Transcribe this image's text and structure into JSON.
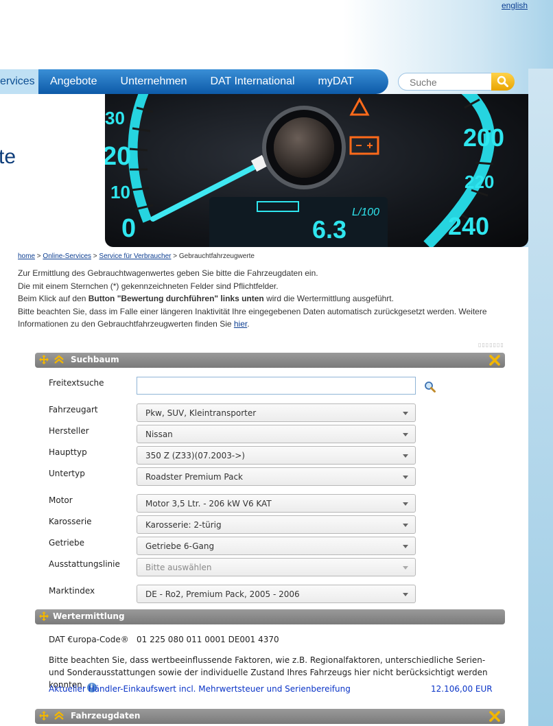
{
  "header": {
    "language_link": "english"
  },
  "nav": {
    "items": [
      {
        "label": "ervices",
        "active": true
      },
      {
        "label": "Angebote"
      },
      {
        "label": "Unternehmen"
      },
      {
        "label": "DAT International"
      },
      {
        "label": "myDAT"
      }
    ],
    "search_placeholder": "Suche"
  },
  "hero": {
    "title_fragment": "te",
    "gauge": {
      "left_ticks": [
        "30",
        "20",
        "10",
        "0"
      ],
      "right_ticks": [
        "200",
        "220",
        "240"
      ],
      "display_unit": "L/100",
      "display_value": "6.3"
    }
  },
  "breadcrumb": {
    "items": [
      "home",
      "Online-Services",
      "Service für Verbraucher"
    ],
    "current": "Gebrauchtfahrzeugwerte",
    "separator": ">"
  },
  "intro": {
    "line1": "Zur Ermittlung des Gebrauchtwagenwertes geben Sie bitte die Fahrzeugdaten ein.",
    "line2": "Die mit einem Sternchen (*) gekennzeichneten Felder sind Pflichtfelder.",
    "line3_pre": "Beim Klick auf den ",
    "line3_bold": "Button \"Bewertung durchführen\" links unten",
    "line3_post": " wird die Wertermittlung ausgeführt.",
    "line4_pre": "Bitte beachten Sie, dass im Falle einer längeren Inaktivität Ihre eingegebenen Daten automatisch zurückgesetzt werden. Weitere Informationen zu den Gebrauchtfahrzeugwerten finden Sie ",
    "line4_link": "hier",
    "line4_post": "."
  },
  "suchbaum": {
    "title": "Suchbaum",
    "freitext_label": "Freitextsuche",
    "freitext_value": "",
    "fields": [
      {
        "label": "Fahrzeugart",
        "value": "Pkw, SUV, Kleintransporter"
      },
      {
        "label": "Hersteller",
        "value": "Nissan"
      },
      {
        "label": "Haupttyp",
        "value": "350 Z (Z33)(07.2003->)"
      },
      {
        "label": "Untertyp",
        "value": "Roadster Premium Pack"
      },
      {
        "label": "Motor",
        "value": "Motor 3,5 Ltr. - 206 kW V6 KAT"
      },
      {
        "label": "Karosserie",
        "value": "Karosserie: 2-türig"
      },
      {
        "label": "Getriebe",
        "value": "Getriebe 6-Gang"
      },
      {
        "label": "Ausstattungslinie",
        "value": "Bitte auswählen",
        "disabled": true
      },
      {
        "label": "Marktindex",
        "value": "DE - Ro2, Premium Pack, 2005 - 2006"
      }
    ]
  },
  "wertermittlung": {
    "title": "Wertermittlung",
    "code_label": "DAT €uropa-Code®",
    "code_value": "01 225 080 011 0001 DE001 4370",
    "note": "Bitte beachten Sie, dass wertbeeinflussende Faktoren, wie z.B. Regionalfaktoren, unterschiedliche Serien- und Sonderausstattungen sowie der individuelle Zustand Ihres Fahrzeugs hier nicht berücksichtigt werden konnten.",
    "price_label": "Aktueller Händler-Einkaufswert incl. Mehrwertsteuer und Serienbereifung",
    "price_value": "12.106,00 EUR"
  },
  "fahrzeugdaten": {
    "title": "Fahrzeugdaten"
  },
  "colors": {
    "nav_blue": "#0d5aa8",
    "gauge_cyan": "#2fe6ef",
    "panel_gray": "#8a8a8a",
    "link_blue": "#0a34c7",
    "accent_yellow": "#f2b600"
  }
}
